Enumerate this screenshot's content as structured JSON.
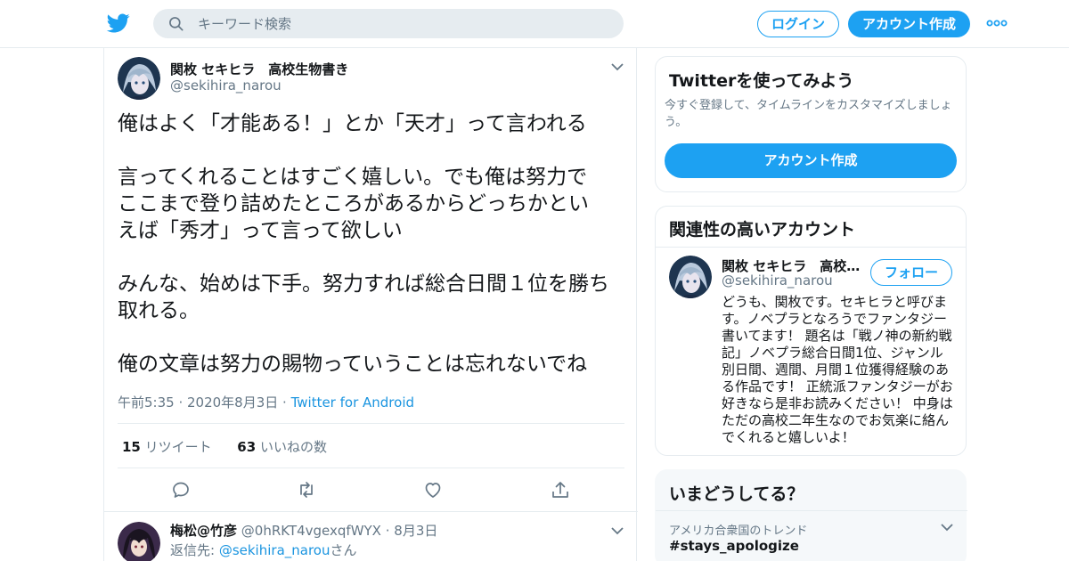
{
  "nav": {
    "search_placeholder": "キーワード検索",
    "login_label": "ログイン",
    "signup_label": "アカウント作成",
    "logo_icon": "twitter-bird-icon",
    "more_icon": "more-dots-icon",
    "search_icon": "search-icon"
  },
  "tweet": {
    "author_name": "関枚 セキヒラ　高校生物書き",
    "author_handle": "@sekihira_narou",
    "body": [
      "俺はよく「才能ある！」とか「天才」って言われる",
      "言ってくれることはすごく嬉しい。でも俺は努力で\nここまで登り詰めたところがあるからどっちかとい\nえば「秀才」って言って欲しい",
      "みんな、始めは下手。努力すれば総合日間１位を勝ち\n取れる。",
      "俺の文章は努力の賜物っていうことは忘れないでね"
    ],
    "time": "午前5:35",
    "date": "2020年8月3日",
    "source": "Twitter for Android",
    "retweet_count": "15",
    "retweet_label": "リツイート",
    "like_count": "63",
    "like_label": "いいねの数"
  },
  "reply": {
    "author_name": "梅松@竹彦",
    "author_handle": "@0hRKT4vgexqfWYX",
    "date": "8月3日",
    "reply_to_prefix": "返信先: ",
    "reply_to_handle": "@sekihira_narou",
    "reply_to_suffix": "さん"
  },
  "sidebar": {
    "try_title": "Twitterを使ってみよう",
    "try_subtitle": "今すぐ登録して、タイムラインをカスタマイズしましょう。",
    "try_cta": "アカウント作成",
    "related_title": "関連性の高いアカウント",
    "related_name": "関枚 セキヒラ　高校生物書き",
    "related_handle": "@sekihira_narou",
    "follow_label": "フォロー",
    "related_bio": "どうも、関枚です。セキヒラと呼びます。ノベプラとなろうでファンタジー書いてます！ 題名は「戦ノ神の新約戦記」ノベプラ総合日間1位、ジャンル別日間、週間、月間１位獲得経験のある作品です！ 正統派ファンタジーがお好きなら是非お読みください！ 中身はただの高校二年生なのでお気楽に絡んでくれると嬉しいよ！",
    "trends_title": "いまどうしてる？",
    "trend_context": "アメリカ合衆国のトレンド",
    "trend_name": "#stays_apologize"
  },
  "colors": {
    "accent": "#1da1f2",
    "link": "#1b95e0",
    "muted": "#657786",
    "border": "#e6ecf0"
  }
}
